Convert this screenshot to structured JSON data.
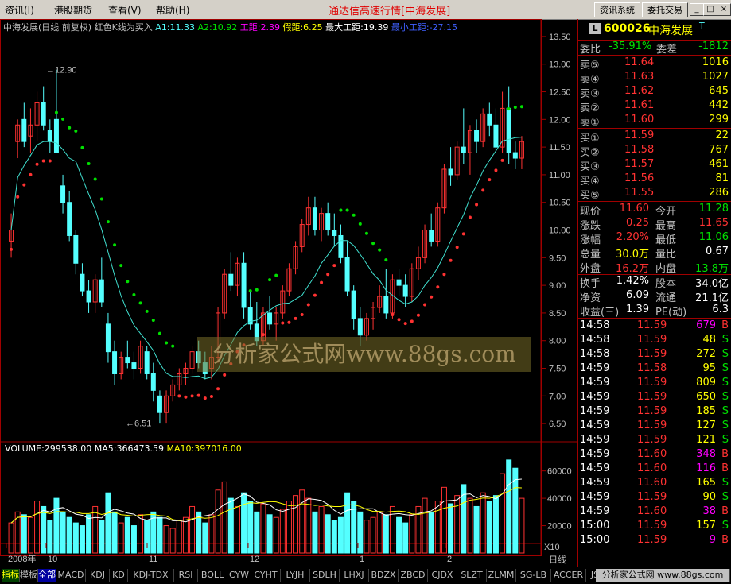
{
  "menu": {
    "items": [
      {
        "label": "资讯(I)",
        "x": 6
      },
      {
        "label": "港股期货",
        "x": 68
      },
      {
        "label": "查看(V)",
        "x": 136
      },
      {
        "label": "帮助(H)",
        "x": 196
      }
    ],
    "title": "通达信高速行情[中海发展]",
    "buttons": [
      "资讯系统",
      "委托交易"
    ]
  },
  "colors": {
    "up": "#ff3232",
    "down": "#54ffff",
    "ma_k": "#ff0000",
    "ma_d": "#00e000",
    "ma_light": "#40e0d0",
    "yellow": "#ffff00",
    "magenta": "#ff00ff",
    "bg": "#000000",
    "grid": "#a00000"
  },
  "indicator_header": {
    "name": "中海发展(日线 前复权) 红色K线为买入",
    "a1": "A1:11.33",
    "a2": "A2:10.92",
    "gongju": "工距:2.39",
    "jiaju": "假距:6.25",
    "max": "最大工距:19.39",
    "min": "最小工距:-27.15"
  },
  "price_axis": [
    "13.50",
    "13.00",
    "12.50",
    "12.00",
    "11.50",
    "11.00",
    "10.50",
    "10.00",
    "9.50",
    "9.00",
    "8.50",
    "8.00",
    "7.50",
    "7.00",
    "6.50"
  ],
  "price_annotations": {
    "high": "12.90",
    "low": "6.51"
  },
  "volume_header": {
    "volume": "VOLUME:299538.00",
    "ma5": "MA5:366473.59",
    "ma10": "MA10:397016.00"
  },
  "volume_axis": [
    "60000",
    "40000",
    "20000"
  ],
  "volume_unit": "X10",
  "date_axis": [
    "2008年",
    "10",
    "11",
    "12",
    "1",
    "2"
  ],
  "period": "日线",
  "watermark": "分析家公式网www.88gs.com",
  "stock": {
    "code": "600026",
    "name": "中海发展",
    "flag": "T"
  },
  "quote": {
    "weibi_label": "委比",
    "weibi": "-35.91%",
    "weicha_label": "委差",
    "weicha": "-1812",
    "sell": [
      {
        "label": "卖⑤",
        "price": "11.64",
        "vol": "1016"
      },
      {
        "label": "卖④",
        "price": "11.63",
        "vol": "1027"
      },
      {
        "label": "卖③",
        "price": "11.62",
        "vol": "645"
      },
      {
        "label": "卖②",
        "price": "11.61",
        "vol": "442"
      },
      {
        "label": "卖①",
        "price": "11.60",
        "vol": "299"
      }
    ],
    "buy": [
      {
        "label": "买①",
        "price": "11.59",
        "vol": "22"
      },
      {
        "label": "买②",
        "price": "11.58",
        "vol": "767"
      },
      {
        "label": "买③",
        "price": "11.57",
        "vol": "461"
      },
      {
        "label": "买④",
        "price": "11.56",
        "vol": "81"
      },
      {
        "label": "买⑤",
        "price": "11.55",
        "vol": "286"
      }
    ],
    "stats": [
      {
        "l1": "现价",
        "v1": "11.60",
        "c1": "#ff3232",
        "l2": "今开",
        "v2": "11.28",
        "c2": "#00e000"
      },
      {
        "l1": "涨跌",
        "v1": "0.25",
        "c1": "#ff3232",
        "l2": "最高",
        "v2": "11.65",
        "c2": "#ff3232"
      },
      {
        "l1": "涨幅",
        "v1": "2.20%",
        "c1": "#ff3232",
        "l2": "最低",
        "v2": "11.06",
        "c2": "#00e000"
      },
      {
        "l1": "总量",
        "v1": "30.0万",
        "c1": "#ffff00",
        "l2": "量比",
        "v2": "0.67",
        "c2": "#ffffff"
      },
      {
        "l1": "外盘",
        "v1": "16.2万",
        "c1": "#ff3232",
        "l2": "内盘",
        "v2": "13.8万",
        "c2": "#00e000"
      },
      {
        "l1": "换手",
        "v1": "1.42%",
        "c1": "#ffffff",
        "l2": "股本",
        "v2": "34.0亿",
        "c2": "#ffffff"
      },
      {
        "l1": "净资",
        "v1": "6.09",
        "c1": "#ffffff",
        "l2": "流通",
        "v2": "21.1亿",
        "c2": "#ffffff"
      },
      {
        "l1": "收益(三)",
        "v1": "1.39",
        "c1": "#ffffff",
        "l2": "PE(动)",
        "v2": "6.3",
        "c2": "#ffffff"
      }
    ],
    "ticks": [
      {
        "time": "14:58",
        "price": "11.59",
        "vol": "679",
        "side": "B"
      },
      {
        "time": "14:58",
        "price": "11.59",
        "vol": "48",
        "side": "S"
      },
      {
        "time": "14:58",
        "price": "11.59",
        "vol": "272",
        "side": "S"
      },
      {
        "time": "14:59",
        "price": "11.58",
        "vol": "95",
        "side": "S"
      },
      {
        "time": "14:59",
        "price": "11.59",
        "vol": "809",
        "side": "S"
      },
      {
        "time": "14:59",
        "price": "11.59",
        "vol": "650",
        "side": "S"
      },
      {
        "time": "14:59",
        "price": "11.59",
        "vol": "185",
        "side": "S"
      },
      {
        "time": "14:59",
        "price": "11.59",
        "vol": "127",
        "side": "S"
      },
      {
        "time": "14:59",
        "price": "11.59",
        "vol": "121",
        "side": "S"
      },
      {
        "time": "14:59",
        "price": "11.60",
        "vol": "348",
        "side": "B"
      },
      {
        "time": "14:59",
        "price": "11.60",
        "vol": "116",
        "side": "B"
      },
      {
        "time": "14:59",
        "price": "11.60",
        "vol": "165",
        "side": "S"
      },
      {
        "time": "14:59",
        "price": "11.59",
        "vol": "90",
        "side": "S"
      },
      {
        "time": "14:59",
        "price": "11.60",
        "vol": "38",
        "side": "B"
      },
      {
        "time": "15:00",
        "price": "11.59",
        "vol": "157",
        "side": "S"
      },
      {
        "time": "15:00",
        "price": "11.59",
        "vol": "9",
        "side": "B"
      }
    ]
  },
  "tabs": [
    "指标",
    "模板",
    "全部",
    "MACD",
    "KDJ",
    "KD",
    "KDJ-TDX",
    "RSI",
    "BOLL",
    "CYW",
    "CYHT",
    "LYJH",
    "SDLH",
    "LHXJ",
    "BDZX",
    "ZBCD",
    "CJDX",
    "SLZT",
    "ZLMM",
    "SG-LB",
    "ACCER",
    "JS",
    "MFI",
    "笔",
    "价",
    "分析家公式网 www.88gs.com"
  ],
  "chart_data": {
    "type": "candlestick",
    "ylim": [
      6.2,
      13.7
    ],
    "candles": [
      [
        9.8,
        10.3,
        9.5,
        10.0
      ],
      [
        11.6,
        12.0,
        11.3,
        11.9
      ],
      [
        12.0,
        12.3,
        11.5,
        11.6
      ],
      [
        11.7,
        12.2,
        11.4,
        11.9
      ],
      [
        11.9,
        12.5,
        11.6,
        12.3
      ],
      [
        12.3,
        12.6,
        11.8,
        11.9
      ],
      [
        11.8,
        12.0,
        11.4,
        11.6
      ],
      [
        12.0,
        12.9,
        11.4,
        11.4
      ],
      [
        10.8,
        11.0,
        10.3,
        10.5
      ],
      [
        10.5,
        10.7,
        9.8,
        9.9
      ],
      [
        9.9,
        10.0,
        9.2,
        9.4
      ],
      [
        9.2,
        9.4,
        8.8,
        8.9
      ],
      [
        8.9,
        9.1,
        8.5,
        8.7
      ],
      [
        8.7,
        9.2,
        8.5,
        9.1
      ],
      [
        9.1,
        9.5,
        8.6,
        8.7
      ],
      [
        8.3,
        8.5,
        7.6,
        7.8
      ],
      [
        7.8,
        8.0,
        7.2,
        7.4
      ],
      [
        7.4,
        7.8,
        7.3,
        7.7
      ],
      [
        7.7,
        8.0,
        7.5,
        7.6
      ],
      [
        7.6,
        7.8,
        7.3,
        7.5
      ],
      [
        7.5,
        8.0,
        7.4,
        7.9
      ],
      [
        7.8,
        7.9,
        7.3,
        7.4
      ],
      [
        7.4,
        7.6,
        6.9,
        7.1
      ],
      [
        7.0,
        7.1,
        6.5,
        6.7
      ],
      [
        6.7,
        7.1,
        6.5,
        7.0
      ],
      [
        7.0,
        7.3,
        6.9,
        7.2
      ],
      [
        7.2,
        7.5,
        7.1,
        7.4
      ],
      [
        7.4,
        7.6,
        7.2,
        7.5
      ],
      [
        7.5,
        7.9,
        7.4,
        7.8
      ],
      [
        7.8,
        8.0,
        7.5,
        7.6
      ],
      [
        7.6,
        7.8,
        7.3,
        7.4
      ],
      [
        7.5,
        7.9,
        7.3,
        7.7
      ],
      [
        7.7,
        8.6,
        7.6,
        8.5
      ],
      [
        8.5,
        9.3,
        8.4,
        9.2
      ],
      [
        9.2,
        9.6,
        8.9,
        9.0
      ],
      [
        9.0,
        9.5,
        8.8,
        9.4
      ],
      [
        9.4,
        9.6,
        8.4,
        8.6
      ],
      [
        8.6,
        8.9,
        8.2,
        8.3
      ],
      [
        8.3,
        8.7,
        7.9,
        8.0
      ],
      [
        8.0,
        8.6,
        7.9,
        8.5
      ],
      [
        8.5,
        8.8,
        8.2,
        8.3
      ],
      [
        8.3,
        8.6,
        8.0,
        8.5
      ],
      [
        8.5,
        9.0,
        8.4,
        8.9
      ],
      [
        8.9,
        9.4,
        8.8,
        9.3
      ],
      [
        9.3,
        9.8,
        9.2,
        9.7
      ],
      [
        9.7,
        10.2,
        9.6,
        10.1
      ],
      [
        10.1,
        10.6,
        9.9,
        10.4
      ],
      [
        10.4,
        10.6,
        9.9,
        10.0
      ],
      [
        10.0,
        10.4,
        9.8,
        10.3
      ],
      [
        10.3,
        10.5,
        9.9,
        10.0
      ],
      [
        10.0,
        10.3,
        9.7,
        9.9
      ],
      [
        9.9,
        10.1,
        9.4,
        9.5
      ],
      [
        9.5,
        9.8,
        8.8,
        8.9
      ],
      [
        8.9,
        9.0,
        8.2,
        8.4
      ],
      [
        8.4,
        8.6,
        7.9,
        8.1
      ],
      [
        8.1,
        8.5,
        8.0,
        8.4
      ],
      [
        8.4,
        8.7,
        8.2,
        8.6
      ],
      [
        8.6,
        9.0,
        8.5,
        8.8
      ],
      [
        8.8,
        9.3,
        8.4,
        8.5
      ],
      [
        8.5,
        9.2,
        8.4,
        9.1
      ],
      [
        9.1,
        9.3,
        8.8,
        9.0
      ],
      [
        9.0,
        9.2,
        8.6,
        8.8
      ],
      [
        8.8,
        9.4,
        8.7,
        9.3
      ],
      [
        9.3,
        9.7,
        9.1,
        9.5
      ],
      [
        9.5,
        10.1,
        9.4,
        10.0
      ],
      [
        10.0,
        10.3,
        9.7,
        9.8
      ],
      [
        9.8,
        10.5,
        9.7,
        10.4
      ],
      [
        10.4,
        11.2,
        10.3,
        11.1
      ],
      [
        11.1,
        11.5,
        10.8,
        11.0
      ],
      [
        11.0,
        11.6,
        10.9,
        11.5
      ],
      [
        11.5,
        12.2,
        11.2,
        11.4
      ],
      [
        11.4,
        11.9,
        11.0,
        11.8
      ],
      [
        11.8,
        12.0,
        11.4,
        11.6
      ],
      [
        11.6,
        12.2,
        11.5,
        12.1
      ],
      [
        12.1,
        12.3,
        11.7,
        11.9
      ],
      [
        11.9,
        12.2,
        11.4,
        11.5
      ],
      [
        11.5,
        12.5,
        11.4,
        12.2
      ],
      [
        12.2,
        12.6,
        11.2,
        11.4
      ],
      [
        11.4,
        11.6,
        11.1,
        11.3
      ],
      [
        11.3,
        11.7,
        11.1,
        11.6
      ]
    ],
    "volumes": [
      22,
      30,
      28,
      26,
      38,
      34,
      24,
      40,
      30,
      26,
      22,
      20,
      28,
      34,
      24,
      44,
      30,
      22,
      26,
      20,
      28,
      24,
      30,
      26,
      20,
      18,
      24,
      26,
      34,
      30,
      22,
      28,
      46,
      52,
      40,
      34,
      44,
      38,
      30,
      36,
      28,
      26,
      32,
      38,
      42,
      46,
      40,
      30,
      34,
      28,
      24,
      26,
      44,
      38,
      30,
      24,
      26,
      30,
      28,
      34,
      26,
      22,
      28,
      34,
      40,
      30,
      38,
      48,
      36,
      42,
      50,
      40,
      34,
      44,
      38,
      42,
      58,
      68,
      62,
      40
    ],
    "vol_ylim": [
      0,
      72000
    ]
  }
}
